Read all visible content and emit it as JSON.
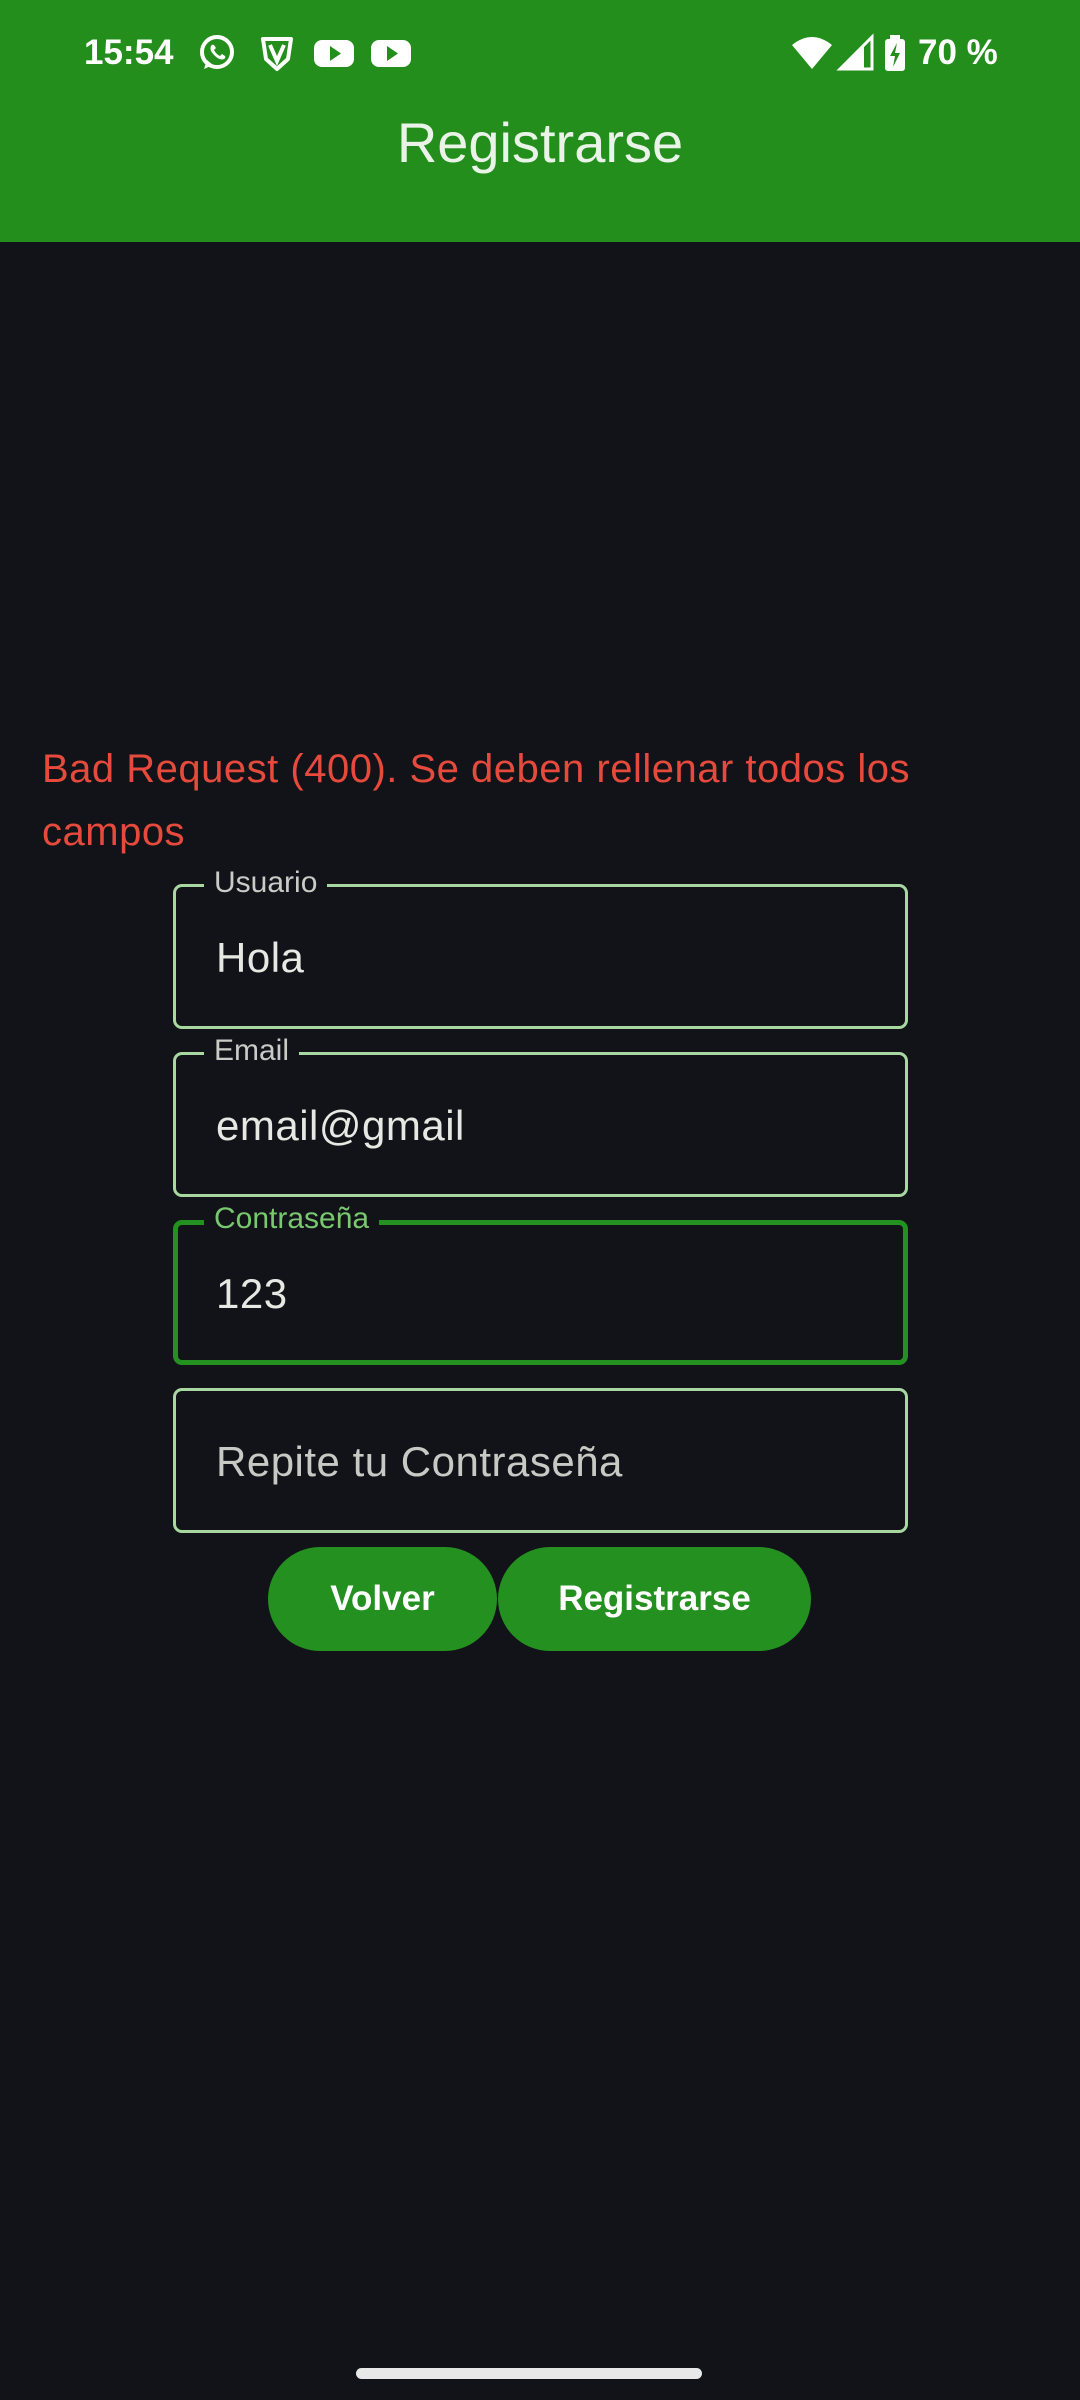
{
  "status_bar": {
    "time": "15:54",
    "battery": "70 %",
    "icons": [
      "whatsapp-icon",
      "vpn-shield-icon",
      "youtube-icon",
      "youtube-icon",
      "wifi-icon",
      "signal-icon",
      "battery-charging-icon"
    ]
  },
  "app_bar": {
    "title": "Registrarse",
    "color": "#238E1C"
  },
  "error": {
    "message": "Bad Request (400). Se deben rellenar todos los campos",
    "color": "#E64A3C"
  },
  "form": {
    "username": {
      "label": "Usuario",
      "value": "Hola"
    },
    "email": {
      "label": "Email",
      "value": "email@gmail"
    },
    "password": {
      "label": "Contraseña",
      "value": "123"
    },
    "repeat_password": {
      "placeholder": "Repite tu Contraseña",
      "value": ""
    }
  },
  "buttons": {
    "back": "Volver",
    "register": "Registrarse"
  }
}
